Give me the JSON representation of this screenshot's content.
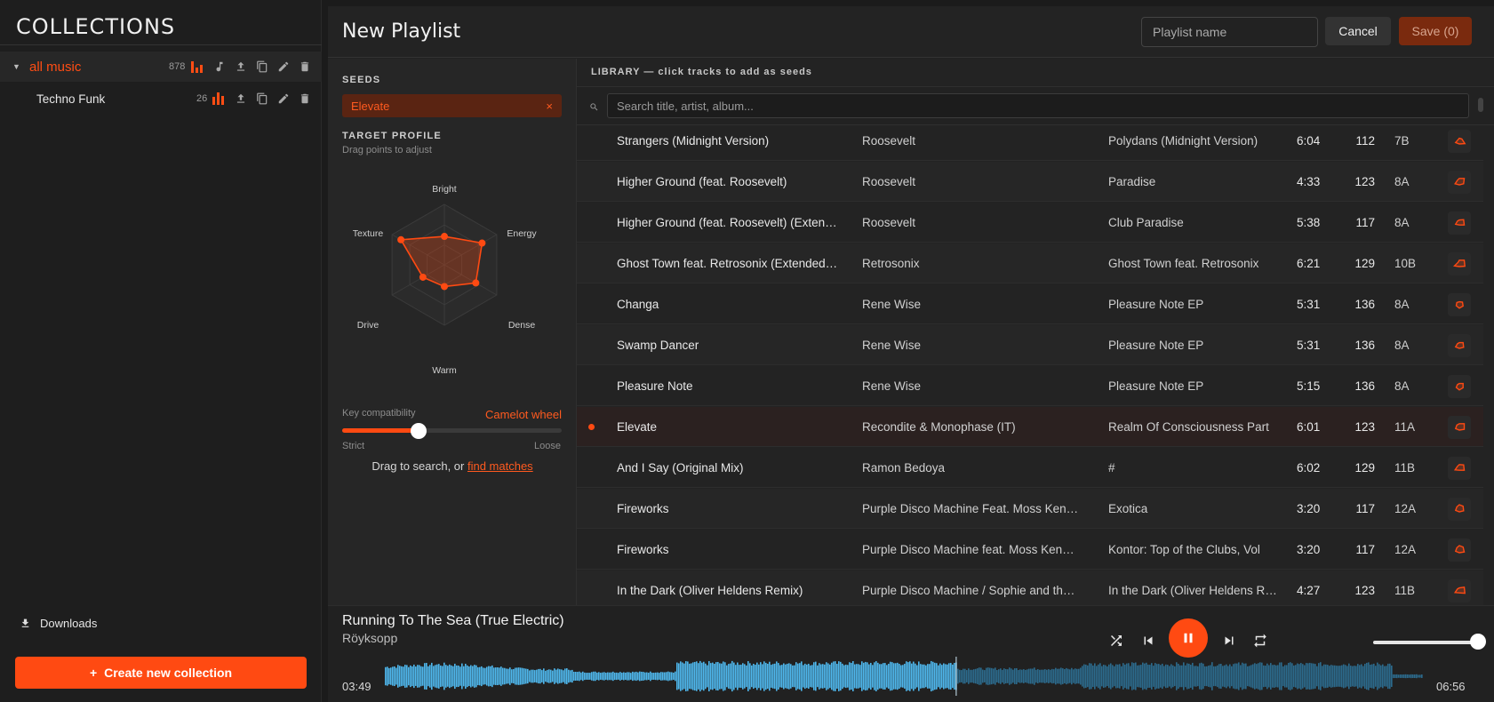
{
  "sidebar": {
    "title": "COLLECTIONS",
    "collections": [
      {
        "name": "all music",
        "count": "878",
        "active": true,
        "expanded": true
      },
      {
        "name": "Techno Funk",
        "count": "26",
        "active": false
      }
    ],
    "downloads_label": "Downloads",
    "create_label": "Create new collection"
  },
  "header": {
    "title": "New Playlist",
    "name_placeholder": "Playlist name",
    "cancel_label": "Cancel",
    "save_label": "Save (0)"
  },
  "seeds_panel": {
    "seeds_label": "SEEDS",
    "seeds": [
      {
        "name": "Elevate",
        "remove": "×"
      }
    ],
    "target_label": "TARGET PROFILE",
    "target_hint": "Drag points to adjust",
    "axes": [
      "Bright",
      "Energy",
      "Dense",
      "Warm",
      "Drive",
      "Texture"
    ],
    "profile_levels": [
      0.47,
      0.72,
      0.6,
      0.36,
      0.41,
      0.83
    ],
    "key_label": "Key compatibility",
    "key_mode": "Camelot wheel",
    "key_value": 0.35,
    "strict_label": "Strict",
    "loose_label": "Loose",
    "drag_hint_prefix": "Drag to search, or ",
    "find_matches": "find matches"
  },
  "library": {
    "header": "LIBRARY — click tracks to add as seeds",
    "search_placeholder": "Search title, artist, album...",
    "tracks": [
      {
        "title": "Strangers (Midnight Version)",
        "artist": "Roosevelt",
        "album": "Polydans (Midnight Version)",
        "duration": "6:04",
        "bpm": "112",
        "key": "7B",
        "shape": [
          0.3,
          0.4,
          0.9,
          0.5,
          0.6,
          0.2
        ]
      },
      {
        "title": "Higher Ground (feat. Roosevelt)",
        "artist": "Roosevelt",
        "album": "Paradise",
        "duration": "4:33",
        "bpm": "123",
        "key": "8A",
        "shape": [
          0.4,
          0.8,
          0.7,
          0.5,
          0.7,
          0.3
        ]
      },
      {
        "title": "Higher Ground (feat. Roosevelt) (Extended Mix)",
        "artist": "Roosevelt",
        "album": "Club Paradise",
        "duration": "5:38",
        "bpm": "117",
        "key": "8A",
        "shape": [
          0.3,
          0.7,
          0.8,
          0.4,
          0.6,
          0.3
        ]
      },
      {
        "title": "Ghost Town feat. Retrosonix (Extended Mix)",
        "artist": "Retrosonix",
        "album": "Ghost Town feat. Retrosonix",
        "duration": "6:21",
        "bpm": "129",
        "key": "10B",
        "shape": [
          0.4,
          0.8,
          0.9,
          0.5,
          0.8,
          0.2
        ]
      },
      {
        "title": "Changa",
        "artist": "Rene Wise",
        "album": "Pleasure Note EP",
        "duration": "5:31",
        "bpm": "136",
        "key": "8A",
        "shape": [
          0.3,
          0.5,
          0.6,
          0.6,
          0.5,
          0.4
        ]
      },
      {
        "title": "Swamp Dancer",
        "artist": "Rene Wise",
        "album": "Pleasure Note EP",
        "duration": "5:31",
        "bpm": "136",
        "key": "8A",
        "shape": [
          0.3,
          0.6,
          0.7,
          0.5,
          0.6,
          0.3
        ]
      },
      {
        "title": "Pleasure Note",
        "artist": "Rene Wise",
        "album": "Pleasure Note EP",
        "duration": "5:15",
        "bpm": "136",
        "key": "8A",
        "shape": [
          0.3,
          0.6,
          0.6,
          0.6,
          0.5,
          0.3
        ]
      },
      {
        "title": "Elevate",
        "artist": "Recondite & Monophase (IT)",
        "album": "Realm Of Consciousness Part",
        "duration": "6:01",
        "bpm": "123",
        "key": "11A",
        "shape": [
          0.4,
          0.8,
          0.8,
          0.5,
          0.6,
          0.4
        ],
        "selected": true
      },
      {
        "title": "And I Say (Original Mix)",
        "artist": "Ramon Bedoya",
        "album": "#",
        "duration": "6:02",
        "bpm": "129",
        "key": "11B",
        "shape": [
          0.4,
          0.7,
          0.8,
          0.4,
          0.7,
          0.3
        ]
      },
      {
        "title": "Fireworks",
        "artist": "Purple Disco Machine Feat. Moss Kena & The Knocks",
        "album": "Exotica",
        "duration": "3:20",
        "bpm": "117",
        "key": "12A",
        "shape": [
          0.5,
          0.6,
          0.7,
          0.5,
          0.6,
          0.4
        ]
      },
      {
        "title": "Fireworks",
        "artist": "Purple Disco Machine feat. Moss Kena & The Knocks",
        "album": "Kontor: Top of the Clubs, Vol",
        "duration": "3:20",
        "bpm": "117",
        "key": "12A",
        "shape": [
          0.5,
          0.6,
          0.8,
          0.5,
          0.6,
          0.4
        ]
      },
      {
        "title": "In the Dark (Oliver Heldens Remix)",
        "artist": "Purple Disco Machine / Sophie and the Giants",
        "album": "In the Dark (Oliver Heldens Remix)",
        "duration": "4:27",
        "bpm": "123",
        "key": "11B",
        "shape": [
          0.3,
          0.8,
          0.9,
          0.4,
          0.7,
          0.3
        ]
      }
    ]
  },
  "player": {
    "title": "Running To The Sea (True Electric)",
    "artist": "Röyksopp",
    "current_time": "03:49",
    "total_time": "06:56",
    "progress": 0.55,
    "volume": 0.92
  },
  "colors": {
    "accent": "#ff4a12",
    "wave_played": "#4fb8ee",
    "wave_unplayed": "#2c6b8d"
  }
}
